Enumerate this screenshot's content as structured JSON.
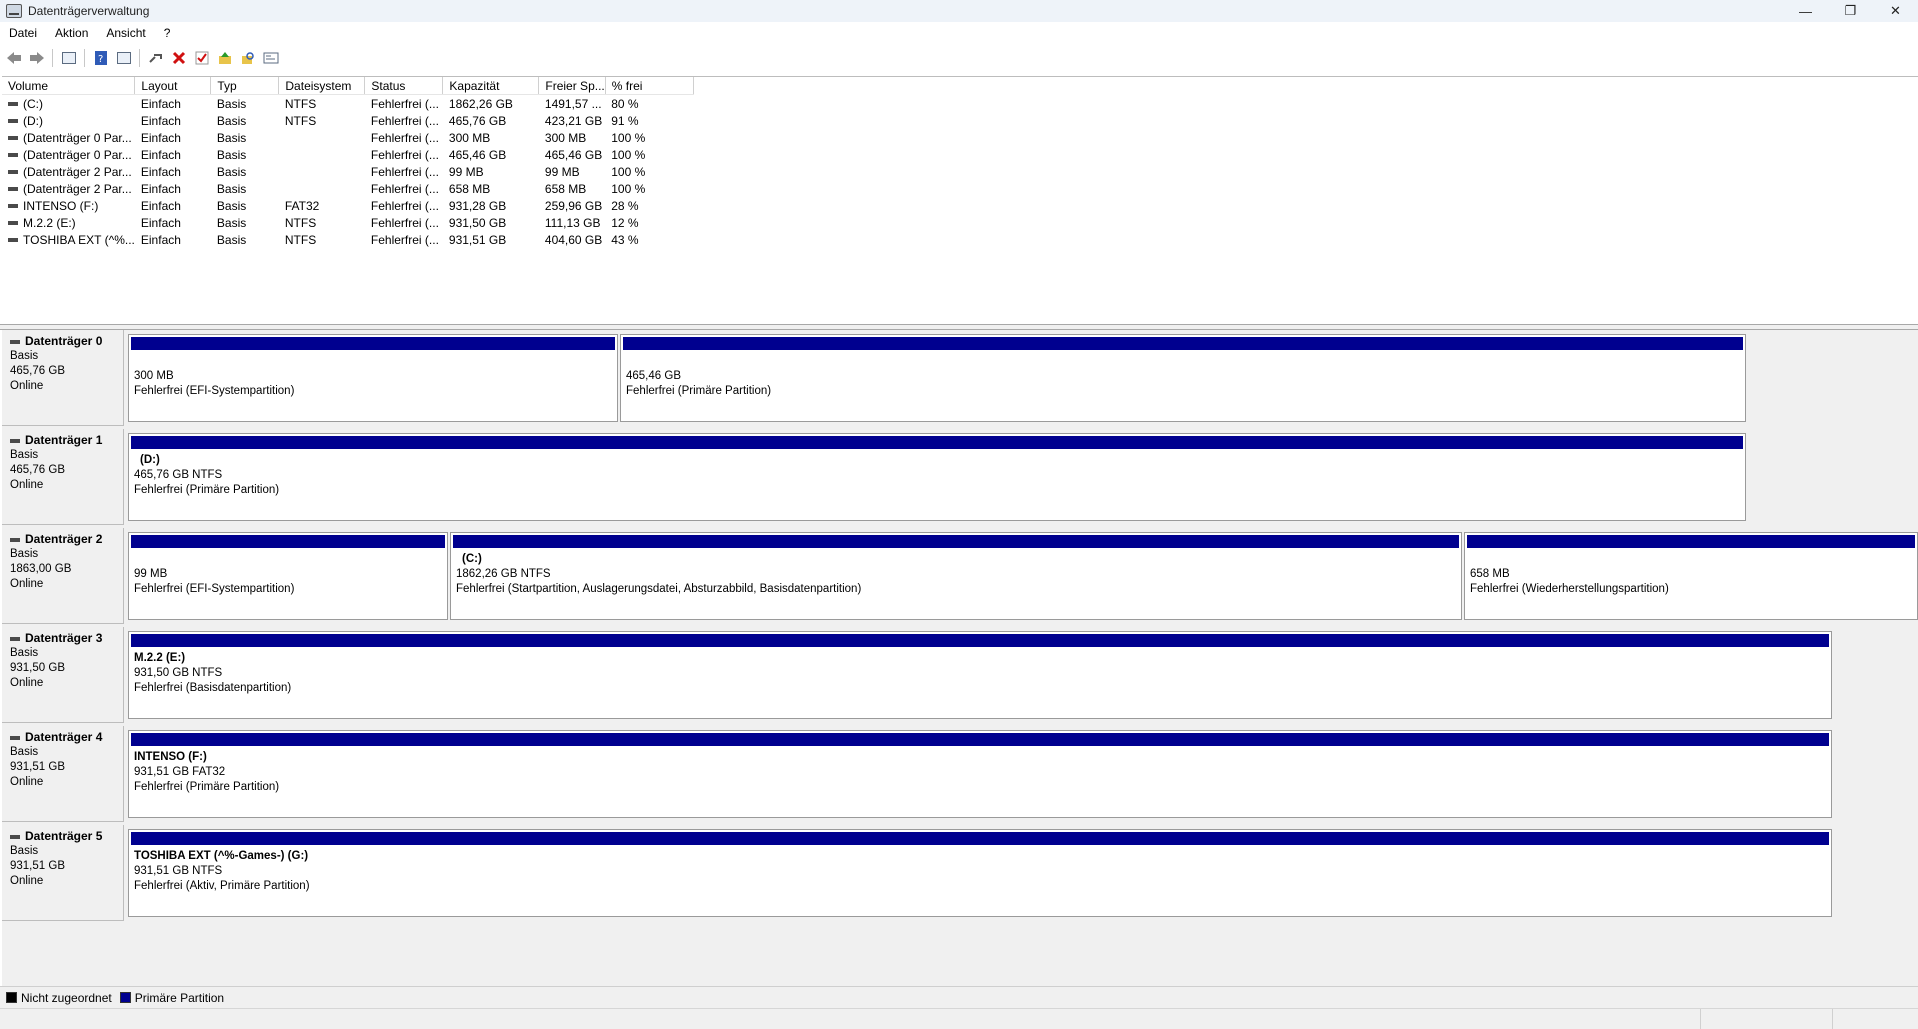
{
  "window": {
    "title": "Datenträgerverwaltung",
    "minimize": "—",
    "maximize": "❐",
    "close": "✕"
  },
  "menu": [
    "Datei",
    "Aktion",
    "Ansicht",
    "?"
  ],
  "toolbar": [
    "back-icon",
    "forward-icon",
    "console-tree-icon",
    "help-icon",
    "show-list-icon",
    "connect-icon",
    "delete-icon",
    "check-icon",
    "up-icon",
    "search-icon",
    "properties-icon"
  ],
  "volume_table": {
    "columns": [
      "Volume",
      "Layout",
      "Typ",
      "Dateisystem",
      "Status",
      "Kapazität",
      "Freier Sp...",
      "% frei"
    ],
    "rows": [
      [
        "(C:)",
        "Einfach",
        "Basis",
        "NTFS",
        "Fehlerfrei (...",
        "1862,26 GB",
        "1491,57 ...",
        "80 %"
      ],
      [
        "(D:)",
        "Einfach",
        "Basis",
        "NTFS",
        "Fehlerfrei (...",
        "465,76 GB",
        "423,21 GB",
        "91 %"
      ],
      [
        "(Datenträger 0 Par...",
        "Einfach",
        "Basis",
        "",
        "Fehlerfrei (...",
        "300 MB",
        "300 MB",
        "100 %"
      ],
      [
        "(Datenträger 0 Par...",
        "Einfach",
        "Basis",
        "",
        "Fehlerfrei (...",
        "465,46 GB",
        "465,46 GB",
        "100 %"
      ],
      [
        "(Datenträger 2 Par...",
        "Einfach",
        "Basis",
        "",
        "Fehlerfrei (...",
        "99 MB",
        "99 MB",
        "100 %"
      ],
      [
        "(Datenträger 2 Par...",
        "Einfach",
        "Basis",
        "",
        "Fehlerfrei (...",
        "658 MB",
        "658 MB",
        "100 %"
      ],
      [
        "INTENSO (F:)",
        "Einfach",
        "Basis",
        "FAT32",
        "Fehlerfrei (...",
        "931,28 GB",
        "259,96 GB",
        "28 %"
      ],
      [
        "M.2.2 (E:)",
        "Einfach",
        "Basis",
        "NTFS",
        "Fehlerfrei (...",
        "931,50 GB",
        "111,13 GB",
        "12 %"
      ],
      [
        "TOSHIBA EXT (^%...",
        "Einfach",
        "Basis",
        "NTFS",
        "Fehlerfrei (...",
        "931,51 GB",
        "404,60 GB",
        "43 %"
      ]
    ]
  },
  "disks": [
    {
      "name": "Datenträger 0",
      "type": "Basis",
      "size": "465,76 GB",
      "state": "Online",
      "partitions": [
        {
          "label": "",
          "line1": "300 MB",
          "line2": "Fehlerfrei (EFI-Systempartition)"
        },
        {
          "label": "",
          "line1": "465,46 GB",
          "line2": "Fehlerfrei (Primäre Partition)"
        }
      ]
    },
    {
      "name": "Datenträger 1",
      "type": "Basis",
      "size": "465,76 GB",
      "state": "Online",
      "partitions": [
        {
          "label": "(D:)",
          "line1": "465,76 GB NTFS",
          "line2": "Fehlerfrei (Primäre Partition)"
        }
      ]
    },
    {
      "name": "Datenträger 2",
      "type": "Basis",
      "size": "1863,00 GB",
      "state": "Online",
      "partitions": [
        {
          "label": "",
          "line1": "99 MB",
          "line2": "Fehlerfrei (EFI-Systempartition)"
        },
        {
          "label": "(C:)",
          "line1": "1862,26 GB NTFS",
          "line2": "Fehlerfrei (Startpartition, Auslagerungsdatei, Absturzabbild, Basisdatenpartition)"
        },
        {
          "label": "",
          "line1": "658 MB",
          "line2": "Fehlerfrei (Wiederherstellungspartition)"
        }
      ]
    },
    {
      "name": "Datenträger 3",
      "type": "Basis",
      "size": "931,50 GB",
      "state": "Online",
      "partitions": [
        {
          "label": "M.2.2  (E:)",
          "line1": "931,50 GB NTFS",
          "line2": "Fehlerfrei (Basisdatenpartition)"
        }
      ]
    },
    {
      "name": "Datenträger 4",
      "type": "Basis",
      "size": "931,51 GB",
      "state": "Online",
      "partitions": [
        {
          "label": "INTENSO  (F:)",
          "line1": "931,51 GB FAT32",
          "line2": "Fehlerfrei (Primäre Partition)"
        }
      ]
    },
    {
      "name": "Datenträger 5",
      "type": "Basis",
      "size": "931,51 GB",
      "state": "Online",
      "partitions": [
        {
          "label": "TOSHIBA EXT (^%-Games-)  (G:)",
          "line1": "931,51 GB NTFS",
          "line2": "Fehlerfrei (Aktiv, Primäre Partition)"
        }
      ]
    }
  ],
  "legend": [
    {
      "label": "Nicht zugeordnet",
      "color": "#000000"
    },
    {
      "label": "Primäre Partition",
      "color": "#00008f"
    }
  ]
}
